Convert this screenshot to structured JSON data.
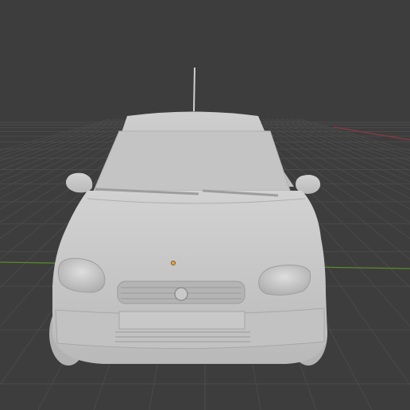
{
  "viewport": {
    "background": "#3d3d3d",
    "grid_color": "#4a4a4a",
    "x_axis_color": "#8a3a44",
    "y_axis_color": "#5a8a2e",
    "origin_color": "#f0a030"
  },
  "scene": {
    "object": "car-model",
    "shading": "solid",
    "object_color": "#c9c9c9"
  },
  "icons": {
    "origin": "object-origin-icon"
  }
}
